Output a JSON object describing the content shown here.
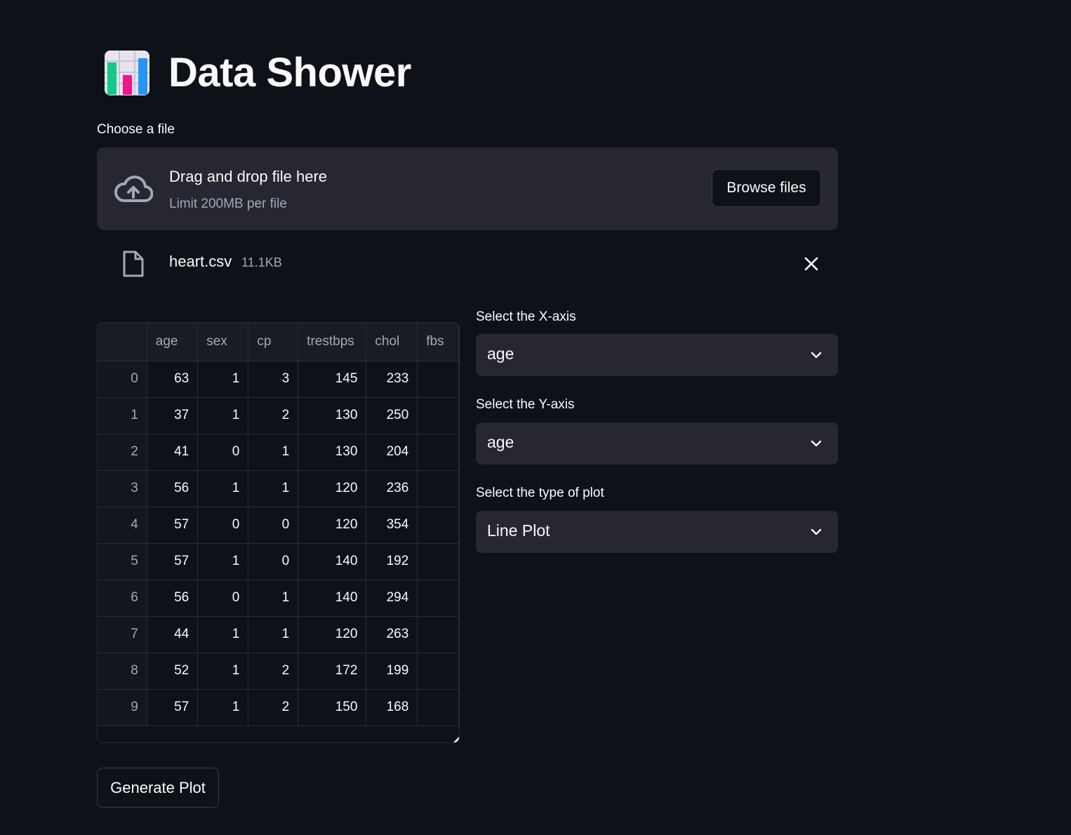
{
  "header": {
    "title": "Data Shower",
    "icon": "bar-chart-icon"
  },
  "uploader": {
    "label": "Choose a file",
    "drag_text": "Drag and drop file here",
    "limit_text": "Limit 200MB per file",
    "browse_label": "Browse files"
  },
  "file": {
    "name": "heart.csv",
    "size": "11.1KB"
  },
  "table": {
    "columns": [
      "",
      "age",
      "sex",
      "cp",
      "trestbps",
      "chol",
      "fbs"
    ],
    "rows": [
      [
        "0",
        "63",
        "1",
        "3",
        "145",
        "233",
        ""
      ],
      [
        "1",
        "37",
        "1",
        "2",
        "130",
        "250",
        ""
      ],
      [
        "2",
        "41",
        "0",
        "1",
        "130",
        "204",
        ""
      ],
      [
        "3",
        "56",
        "1",
        "1",
        "120",
        "236",
        ""
      ],
      [
        "4",
        "57",
        "0",
        "0",
        "120",
        "354",
        ""
      ],
      [
        "5",
        "57",
        "1",
        "0",
        "140",
        "192",
        ""
      ],
      [
        "6",
        "56",
        "0",
        "1",
        "140",
        "294",
        ""
      ],
      [
        "7",
        "44",
        "1",
        "1",
        "120",
        "263",
        ""
      ],
      [
        "8",
        "52",
        "1",
        "2",
        "172",
        "199",
        ""
      ],
      [
        "9",
        "57",
        "1",
        "2",
        "150",
        "168",
        ""
      ]
    ]
  },
  "x_axis": {
    "label": "Select the X-axis",
    "value": "age"
  },
  "y_axis": {
    "label": "Select the Y-axis",
    "value": "age"
  },
  "plot_type": {
    "label": "Select the type of plot",
    "value": "Line Plot"
  },
  "generate_label": "Generate Plot",
  "colors": {
    "background": "#0e1117",
    "surface": "#262730",
    "text": "#fafafa",
    "muted": "#a3a8b8"
  }
}
